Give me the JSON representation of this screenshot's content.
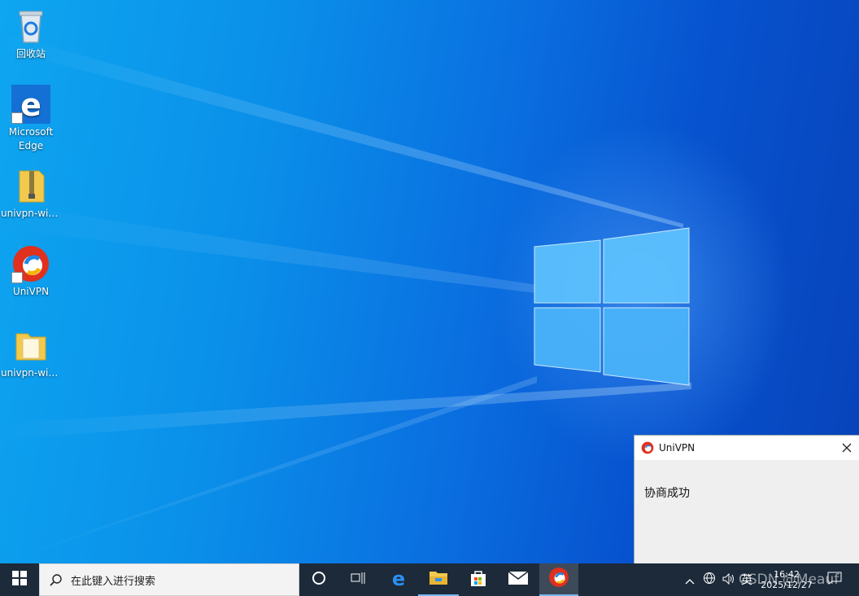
{
  "desktop": {
    "icons": [
      {
        "label": "回收站",
        "icon": "recycle-bin-icon"
      },
      {
        "label": "Microsoft Edge",
        "line1": "Microsoft",
        "line2": "Edge",
        "icon": "edge-icon"
      },
      {
        "label": "univpn-win...",
        "icon": "zip-folder-icon"
      },
      {
        "label": "UniVPN",
        "icon": "univpn-icon"
      },
      {
        "label": "univpn-win...",
        "icon": "folder-icon"
      }
    ]
  },
  "notification": {
    "app_name": "UniVPN",
    "message": "协商成功",
    "close_icon": "close-icon"
  },
  "taskbar": {
    "search_placeholder": "在此键入进行搜索",
    "pinned": [
      "cortana-icon",
      "task-view-icon",
      "edge-icon",
      "file-explorer-icon",
      "store-icon",
      "mail-icon",
      "univpn-icon"
    ],
    "tray": {
      "ime": "英",
      "time": "16:42",
      "date": "2025/12/27",
      "notification_count": "1"
    }
  },
  "watermark": "CSDN @Meauf",
  "colors": {
    "taskbar": "#1c2a3a",
    "desktop_accent": "#0a6fe0",
    "univpn_red": "#e0301e"
  }
}
